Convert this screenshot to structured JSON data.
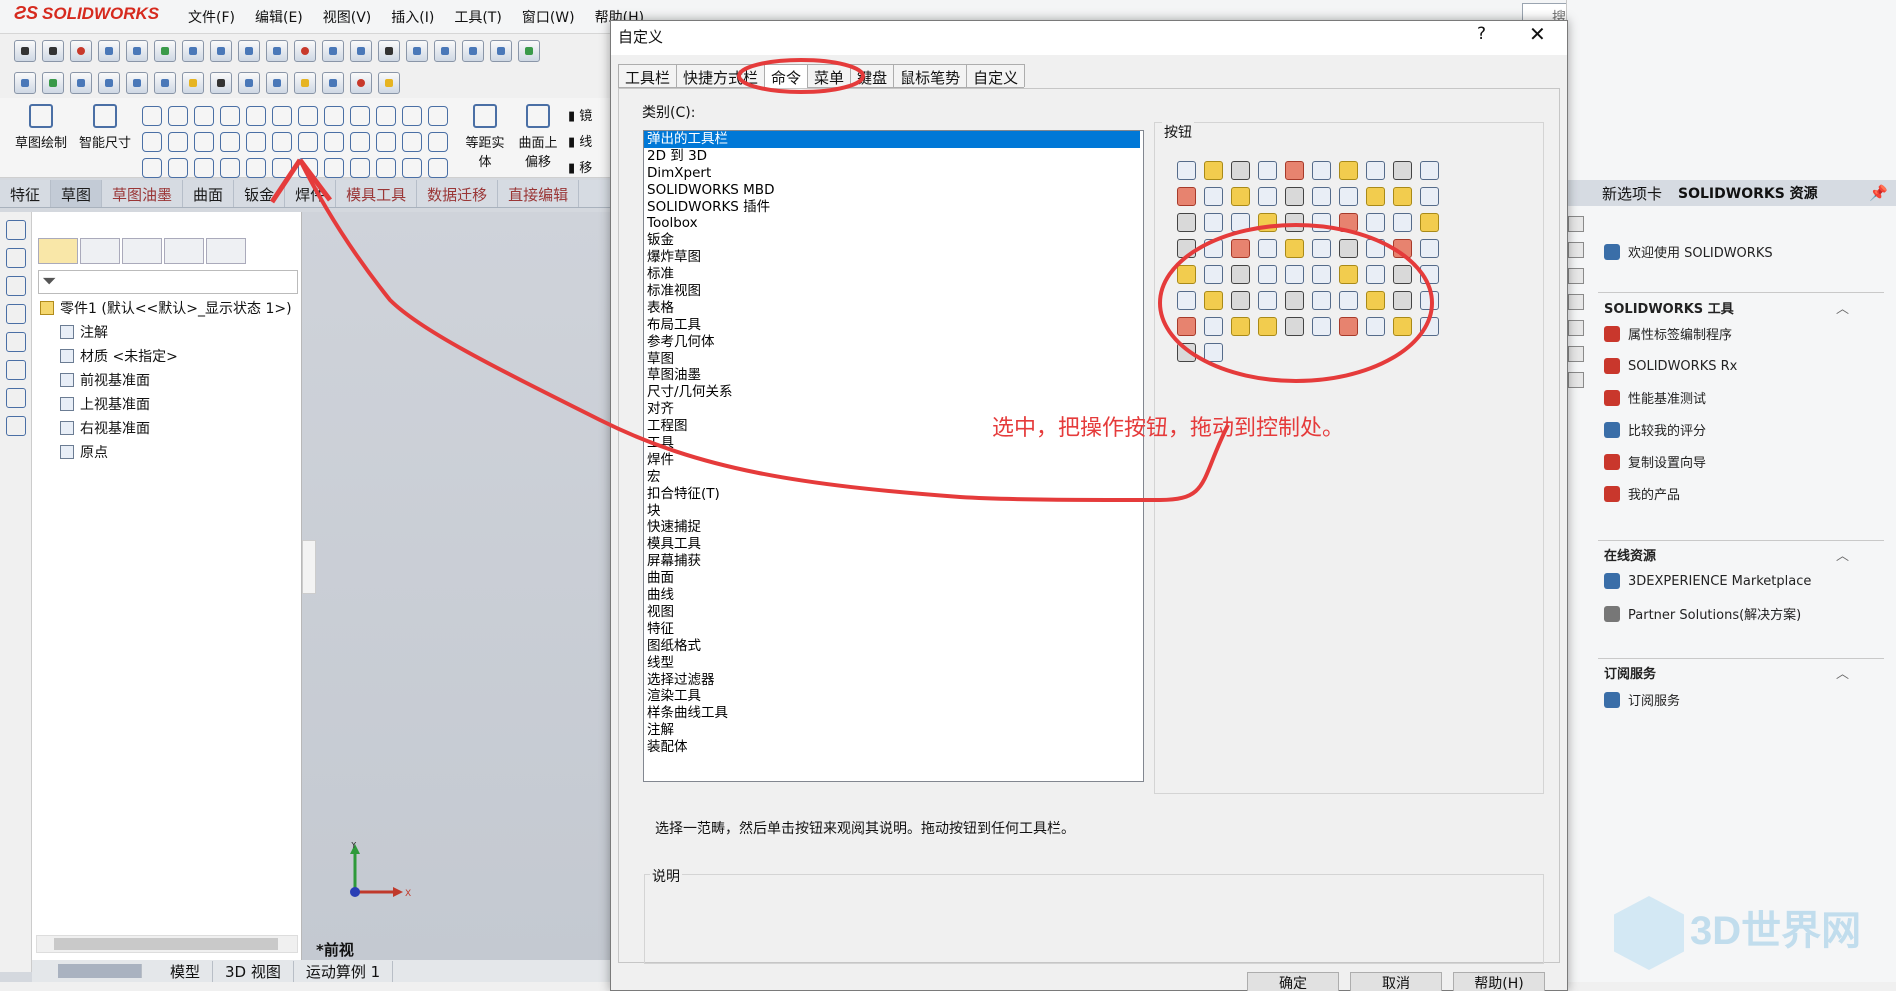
{
  "app": {
    "logo": "SOLIDWORKS",
    "menu": [
      "文件(F)",
      "编辑(E)",
      "视图(V)",
      "插入(I)",
      "工具(T)",
      "窗口(W)",
      "帮助(H)"
    ],
    "search_placeholder": "搜索命令"
  },
  "sketch_toolbar": {
    "sketch_label": "草图绘制",
    "smart_dim_label": "智能尺寸",
    "offset_entity_label": "等距实体",
    "surface_offset_label": "曲面上偏移",
    "mirror_label": "镜",
    "line_label": "线",
    "move_label": "移"
  },
  "command_tabs": [
    "特征",
    "草图",
    "草图油墨",
    "曲面",
    "钣金",
    "焊件",
    "模具工具",
    "数据迁移",
    "直接编辑"
  ],
  "feature_tree": {
    "root": "零件1 (默认<<默认>_显示状态 1>)",
    "items": [
      "注解",
      "材质 <未指定>",
      "前视基准面",
      "上视基准面",
      "右视基准面",
      "原点"
    ]
  },
  "bottom_tabs": [
    "模型",
    "3D 视图",
    "运动算例 1"
  ],
  "viewport": {
    "view_label": "*前视",
    "axis_y": "Y",
    "axis_x": "X"
  },
  "dialog": {
    "title": "自定义",
    "help_glyph": "?",
    "close_glyph": "✕",
    "tabs": [
      "工具栏",
      "快捷方式栏",
      "命令",
      "菜单",
      "键盘",
      "鼠标笔势",
      "自定义"
    ],
    "active_tab": "命令",
    "category_label": "类别(C):",
    "categories": [
      "弹出的工具栏",
      "2D 到 3D",
      "DimXpert",
      "SOLIDWORKS MBD",
      "SOLIDWORKS 插件",
      "Toolbox",
      "钣金",
      "爆炸草图",
      "标准",
      "标准视图",
      "表格",
      "布局工具",
      "参考几何体",
      "草图",
      "草图油墨",
      "尺寸/几何关系",
      "对齐",
      "工程图",
      "工具",
      "焊件",
      "宏",
      "扣合特征(T)",
      "块",
      "快速捕捉",
      "模具工具",
      "屏幕捕获",
      "曲面",
      "曲线",
      "视图",
      "特征",
      "图纸格式",
      "线型",
      "选择过滤器",
      "渲染工具",
      "样条曲线工具",
      "注解",
      "装配体"
    ],
    "selected_category": "弹出的工具栏",
    "buttons_label": "按钮",
    "hint": "选择一范畴，然后单击按钮来观阅其说明。拖动按钮到任何工具栏。",
    "description_label": "说明",
    "ok_label": "确定",
    "cancel_label": "取消",
    "help_label": "帮助(H)"
  },
  "task_pane": {
    "tab_new": "新选项卡",
    "title": "SOLIDWORKS 资源",
    "welcome": "欢迎使用  SOLIDWORKS",
    "sections": [
      {
        "title": "SOLIDWORKS 工具",
        "items": [
          "属性标签编制程序",
          "SOLIDWORKS Rx",
          "性能基准测试",
          "比较我的评分",
          "复制设置向导",
          "我的产品"
        ]
      },
      {
        "title": "在线资源",
        "items": [
          "3DEXPERIENCE Marketplace",
          "Partner Solutions(解决方案)"
        ]
      },
      {
        "title": "订阅服务",
        "items": [
          "订阅服务"
        ]
      }
    ]
  },
  "annotation": {
    "note": "选中，把操作按钮，拖动到控制处。",
    "color": "#e53b3b"
  },
  "watermark": "3D世界网"
}
